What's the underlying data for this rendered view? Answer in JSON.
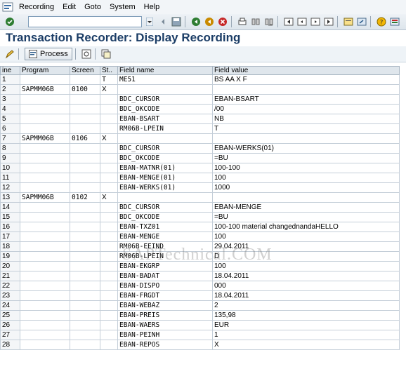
{
  "menu": [
    "Recording",
    "Edit",
    "Goto",
    "System",
    "Help"
  ],
  "title": "Transaction Recorder: Display Recording",
  "toolbar2": {
    "process_label": "Process"
  },
  "table": {
    "headers": [
      "ine",
      "Program",
      "Screen",
      "St..",
      "Field name",
      "Field value"
    ],
    "rows": [
      [
        "1",
        "",
        "",
        "T",
        "ME51",
        "BS AA X  F"
      ],
      [
        "2",
        "SAPMM06B",
        "0100",
        "X",
        "",
        ""
      ],
      [
        "3",
        "",
        "",
        "",
        "BDC_CURSOR",
        "EBAN-BSART"
      ],
      [
        "4",
        "",
        "",
        "",
        "BDC_OKCODE",
        "/00"
      ],
      [
        "5",
        "",
        "",
        "",
        "EBAN-BSART",
        "NB"
      ],
      [
        "6",
        "",
        "",
        "",
        "RM06B-LPEIN",
        "T"
      ],
      [
        "7",
        "SAPMM06B",
        "0106",
        "X",
        "",
        ""
      ],
      [
        "8",
        "",
        "",
        "",
        "BDC_CURSOR",
        "EBAN-WERKS(01)"
      ],
      [
        "9",
        "",
        "",
        "",
        "BDC_OKCODE",
        "=BU"
      ],
      [
        "10",
        "",
        "",
        "",
        "EBAN-MATNR(01)",
        "100-100"
      ],
      [
        "11",
        "",
        "",
        "",
        "EBAN-MENGE(01)",
        "100"
      ],
      [
        "12",
        "",
        "",
        "",
        "EBAN-WERKS(01)",
        "1000"
      ],
      [
        "13",
        "SAPMM06B",
        "0102",
        "X",
        "",
        ""
      ],
      [
        "14",
        "",
        "",
        "",
        "BDC_CURSOR",
        "EBAN-MENGE"
      ],
      [
        "15",
        "",
        "",
        "",
        "BDC_OKCODE",
        "=BU"
      ],
      [
        "16",
        "",
        "",
        "",
        "EBAN-TXZ01",
        "100-100 material changednandaHELLO"
      ],
      [
        "17",
        "",
        "",
        "",
        "EBAN-MENGE",
        "100"
      ],
      [
        "18",
        "",
        "",
        "",
        "RM06B-EEIND",
        "29.04.2011"
      ],
      [
        "19",
        "",
        "",
        "",
        "RM06B-LPEIN",
        "D"
      ],
      [
        "20",
        "",
        "",
        "",
        "EBAN-EKGRP",
        "100"
      ],
      [
        "21",
        "",
        "",
        "",
        "EBAN-BADAT",
        "18.04.2011"
      ],
      [
        "22",
        "",
        "",
        "",
        "EBAN-DISPO",
        "000"
      ],
      [
        "23",
        "",
        "",
        "",
        "EBAN-FRGDT",
        "18.04.2011"
      ],
      [
        "24",
        "",
        "",
        "",
        "EBAN-WEBAZ",
        "2"
      ],
      [
        "25",
        "",
        "",
        "",
        "EBAN-PREIS",
        "    135,98"
      ],
      [
        "26",
        "",
        "",
        "",
        "EBAN-WAERS",
        "EUR"
      ],
      [
        "27",
        "",
        "",
        "",
        "EBAN-PEINH",
        "1"
      ],
      [
        "28",
        "",
        "",
        "",
        "EBAN-REPOS",
        "X"
      ]
    ]
  },
  "watermark": "SAPTechnical.COM",
  "colors": {
    "title": "#1b3d66",
    "header_bg": "#dfe6ec",
    "toolbar_bg": "#eef2f6"
  },
  "icons": [
    "sap-logo-icon",
    "enter-icon",
    "save-icon",
    "back-icon",
    "exit-icon",
    "cancel-icon",
    "print-icon",
    "find-icon",
    "find-next-icon",
    "first-page-icon",
    "previous-page-icon",
    "next-page-icon",
    "last-page-icon",
    "new-session-icon",
    "shortcut-icon",
    "help-icon",
    "customize-layout-icon",
    "edit-icon",
    "process-icon",
    "display-icon",
    "copy-icon"
  ]
}
